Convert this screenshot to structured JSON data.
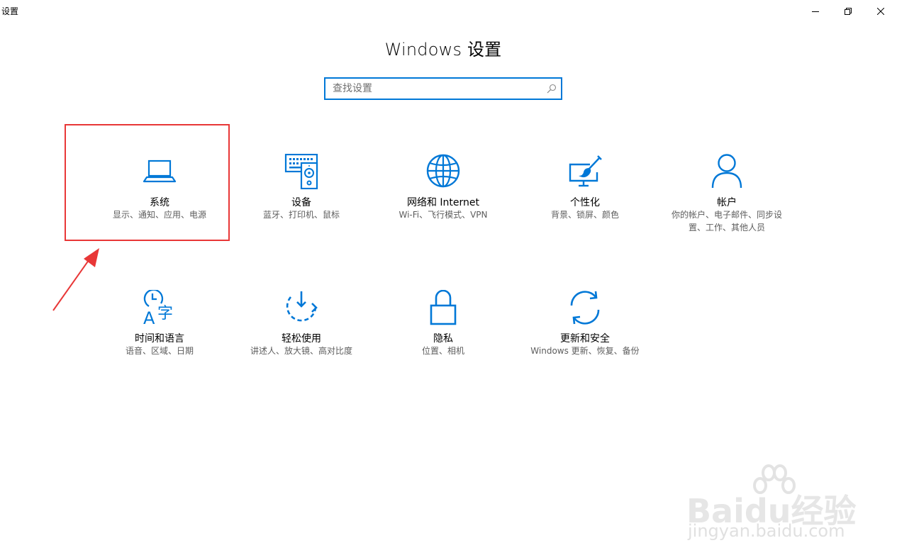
{
  "window": {
    "title": "设置",
    "controls": {
      "minimize": "minimize-icon",
      "maximize": "restore-icon",
      "close": "close-icon"
    }
  },
  "page": {
    "title": "Windows 设置"
  },
  "search": {
    "placeholder": "查找设置",
    "value": ""
  },
  "tiles": [
    {
      "name": "系统",
      "desc": "显示、通知、应用、电源",
      "icon": "laptop-icon"
    },
    {
      "name": "设备",
      "desc": "蓝牙、打印机、鼠标",
      "icon": "devices-icon"
    },
    {
      "name": "网络和 Internet",
      "desc": "Wi-Fi、飞行模式、VPN",
      "icon": "globe-icon"
    },
    {
      "name": "个性化",
      "desc": "背景、锁屏、颜色",
      "icon": "personalization-icon"
    },
    {
      "name": "帐户",
      "desc": "你的帐户、电子邮件、同步设置、工作、其他人员",
      "icon": "person-icon"
    },
    {
      "name": "时间和语言",
      "desc": "语音、区域、日期",
      "icon": "time-language-icon"
    },
    {
      "name": "轻松使用",
      "desc": "讲述人、放大镜、高对比度",
      "icon": "ease-of-access-icon"
    },
    {
      "name": "隐私",
      "desc": "位置、相机",
      "icon": "lock-icon"
    },
    {
      "name": "更新和安全",
      "desc": "Windows 更新、恢复、备份",
      "icon": "refresh-icon"
    }
  ],
  "annotation": {
    "highlight_color": "#e83737"
  },
  "watermark": {
    "brand": "Baidu经验",
    "url": "jingyan.baidu.com"
  },
  "colors": {
    "accent": "#0078d7",
    "text": "#000000",
    "subtext": "#5d5d5d",
    "background": "#ffffff"
  }
}
